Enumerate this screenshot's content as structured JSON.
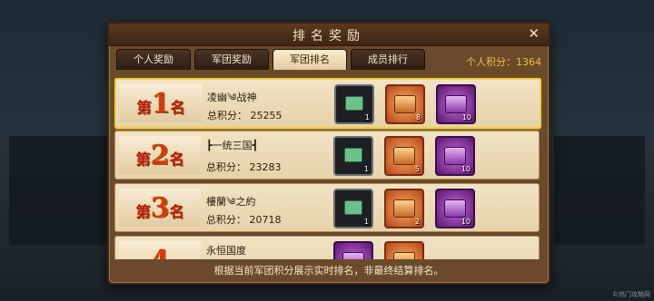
{
  "window": {
    "title": "排名奖励",
    "close_icon": "close-icon"
  },
  "tabs": [
    {
      "label": "个人奖励"
    },
    {
      "label": "军团奖励"
    },
    {
      "label": "军团排名",
      "active": true
    },
    {
      "label": "成员排行"
    }
  ],
  "personal_score": "个人积分：1364",
  "rows": [
    {
      "rank_prefix": "第",
      "rank_num": "1",
      "rank_suffix": "名",
      "name": "凌幽༄战神",
      "total": "总积分：  25255",
      "rewards": [
        {
          "type": "card",
          "count": "1"
        },
        {
          "type": "gold-chest",
          "count": "8"
        },
        {
          "type": "purple-chest",
          "count": "10"
        }
      ]
    },
    {
      "rank_prefix": "第",
      "rank_num": "2",
      "rank_suffix": "名",
      "name": "┣一统三国┫",
      "total": "总积分：  23283",
      "rewards": [
        {
          "type": "card",
          "count": "1"
        },
        {
          "type": "gold-chest",
          "count": "5"
        },
        {
          "type": "purple-chest",
          "count": "10"
        }
      ]
    },
    {
      "rank_prefix": "第",
      "rank_num": "3",
      "rank_suffix": "名",
      "name": "樓蘭༄之約",
      "total": "总积分：  20718",
      "rewards": [
        {
          "type": "card",
          "count": "1"
        },
        {
          "type": "gold-chest",
          "count": "2"
        },
        {
          "type": "purple-chest",
          "count": "10"
        }
      ]
    },
    {
      "rank_prefix": "",
      "rank_num": "4",
      "rank_suffix": "",
      "name": "永恒国度",
      "total": "",
      "rewards": [
        {
          "type": "purple-chest",
          "count": ""
        },
        {
          "type": "purple-chest",
          "count": ""
        }
      ]
    }
  ],
  "footer_note": "根据当前军团积分展示实时排名，非最终结算排名。",
  "watermark": "©热门攻略网",
  "colors": {
    "accent_gold": "#f0c040",
    "rank_red": "#b31a10"
  }
}
